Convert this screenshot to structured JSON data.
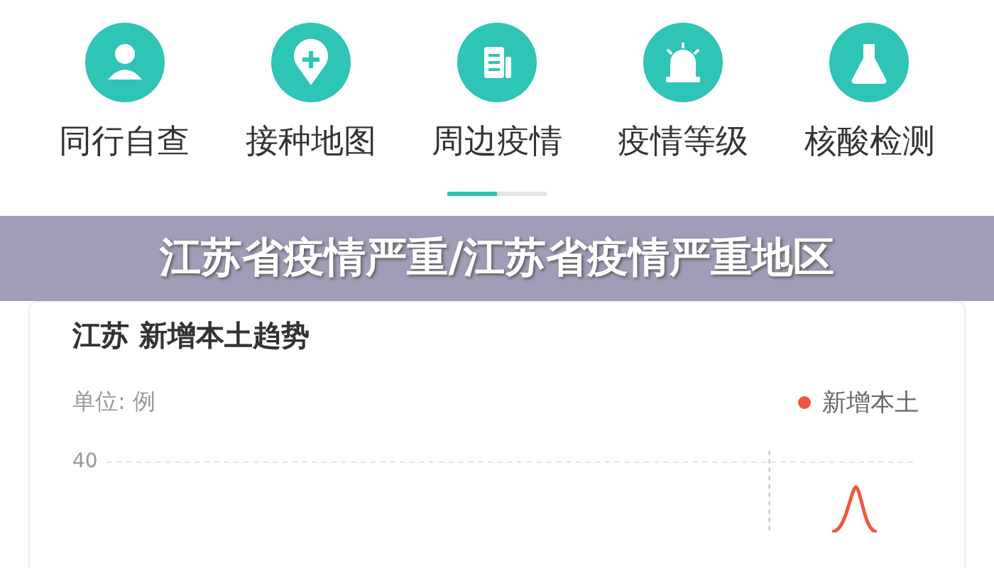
{
  "shortcuts": [
    {
      "label": "同行自查",
      "kind": "person"
    },
    {
      "label": "接种地图",
      "kind": "pin"
    },
    {
      "label": "周边疫情",
      "kind": "doc"
    },
    {
      "label": "疫情等级",
      "kind": "alarm"
    },
    {
      "label": "核酸检测",
      "kind": "flask"
    }
  ],
  "pager": [
    {
      "selected": true
    },
    {
      "selected": false
    }
  ],
  "banner": {
    "title": "江苏省疫情严重/江苏省疫情严重地区"
  },
  "card": {
    "title": "江苏 新增本土趋势",
    "unit": "单位: 例",
    "legend": [
      {
        "label": "新增本土",
        "color": "#f0573f"
      }
    ],
    "y_tick": "40"
  }
}
